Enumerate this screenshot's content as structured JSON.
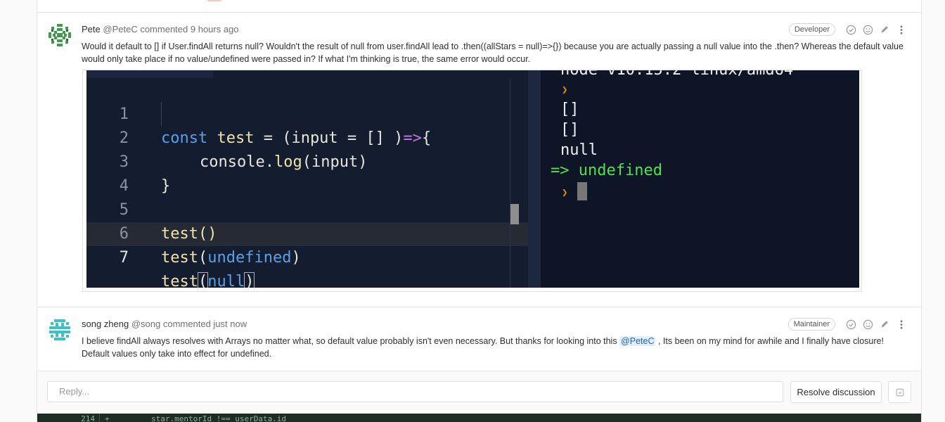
{
  "notes": [
    {
      "author_name": "Pete",
      "author_handle": "@PeteC",
      "action": "commented",
      "time": "9 hours ago",
      "role": "Developer",
      "body": "Would it default to [] if User.findAll returns null? Wouldn't the result of null from user.findAll lead to .then((allStars = null)=>{}) because you are actually passing a null value into the .then? Whereas the default value would only take place if no value/undefined were passed in? If what I'm thinking is true, the same error would occur.",
      "screenshot": {
        "code_lines": [
          {
            "n": "1",
            "text": "const test = (input = [] )=>{"
          },
          {
            "n": "2",
            "text": "console.log(input)"
          },
          {
            "n": "3",
            "text": "}"
          },
          {
            "n": "4",
            "text": ""
          },
          {
            "n": "5",
            "text": "test()"
          },
          {
            "n": "6",
            "text": "test(undefined)"
          },
          {
            "n": "7",
            "text": "test(null)"
          }
        ],
        "terminal": {
          "header": "node v10.15.2 linux/amd64",
          "prompt": "❯",
          "outputs": [
            "[]",
            "[]",
            "null"
          ],
          "result": "=> undefined"
        }
      }
    },
    {
      "author_name": "song zheng",
      "author_handle": "@song",
      "action": "commented",
      "time": "just now",
      "role": "Maintainer",
      "body_before": "I believe findAll always resolves with Arrays no matter what, so default value probably isn't even necessary. But thanks for looking into this ",
      "mention": "@PeteC",
      "body_after": " , Its been on my mind for awhile and I finally have closure! Default values only take into effect for undefined."
    }
  ],
  "reply": {
    "placeholder": "Reply...",
    "resolve_label": "Resolve discussion"
  },
  "diff": {
    "line_number": "214",
    "sign": "+",
    "code": "star.mentorId !== userData.id"
  },
  "colors": {
    "mention_bg": "#e4edf8",
    "mention_text": "#1b69b6",
    "terminal_green": "#4ee34e",
    "prompt_orange": "#f08c00"
  }
}
